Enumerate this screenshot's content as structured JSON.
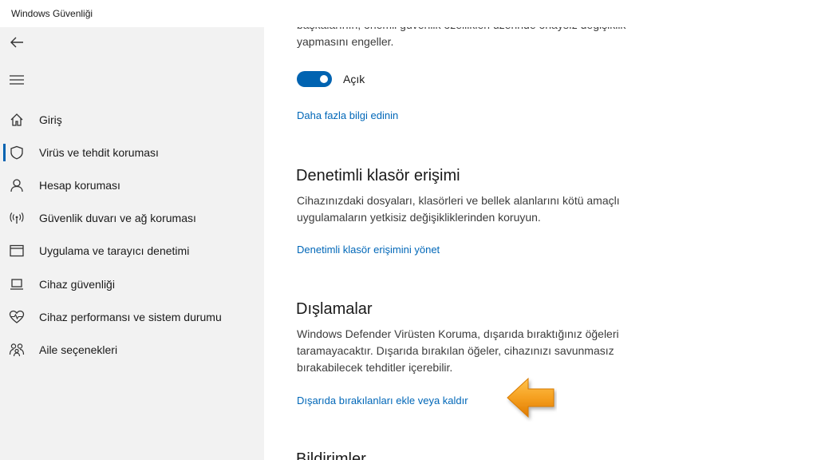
{
  "window": {
    "title": "Windows Güvenliği"
  },
  "sidebar": {
    "icons": {
      "back": "back-arrow-icon",
      "menu": "hamburger-icon"
    },
    "items": [
      {
        "label": "Giriş",
        "icon": "home-icon",
        "active": false
      },
      {
        "label": "Virüs ve tehdit koruması",
        "icon": "shield-icon",
        "active": true
      },
      {
        "label": "Hesap koruması",
        "icon": "person-icon",
        "active": false
      },
      {
        "label": "Güvenlik duvarı ve ağ koruması",
        "icon": "wireless-icon",
        "active": false
      },
      {
        "label": "Uygulama ve tarayıcı denetimi",
        "icon": "browser-window-icon",
        "active": false
      },
      {
        "label": "Cihaz güvenliği",
        "icon": "laptop-icon",
        "active": false
      },
      {
        "label": "Cihaz performansı ve sistem durumu",
        "icon": "heart-icon",
        "active": false
      },
      {
        "label": "Aile seçenekleri",
        "icon": "family-icon",
        "active": false
      }
    ],
    "accent_color": "#0063b1"
  },
  "main": {
    "tamper": {
      "description_line1": "başkalarının, önemli güvenlik özellikleri üzerinde onaysız değişiklik",
      "description_line2": "yapmasını engeller.",
      "toggle_label": "Açık",
      "toggle_on": true,
      "link": "Daha fazla bilgi edinin"
    },
    "controlled_folder": {
      "heading": "Denetimli klasör erişimi",
      "description_line1": "Cihazınızdaki dosyaları, klasörleri ve bellek alanlarını kötü amaçlı",
      "description_line2": "uygulamaların yetkisiz değişikliklerinden koruyun.",
      "link": "Denetimli klasör erişimini yönet"
    },
    "exclusions": {
      "heading": "Dışlamalar",
      "description_line1": "Windows Defender Virüsten Koruma, dışarıda bıraktığınız öğeleri",
      "description_line2": "taramayacaktır. Dışarıda bırakılan öğeler, cihazınızı savunmasız",
      "description_line3": "bırakabilecek tehditler içerebilir.",
      "link": "Dışarıda bırakılanları ekle veya kaldır"
    },
    "notifications": {
      "heading": "Bildirimler"
    },
    "link_color": "#0067b8",
    "annotation_arrow_color": "#f39c12"
  }
}
